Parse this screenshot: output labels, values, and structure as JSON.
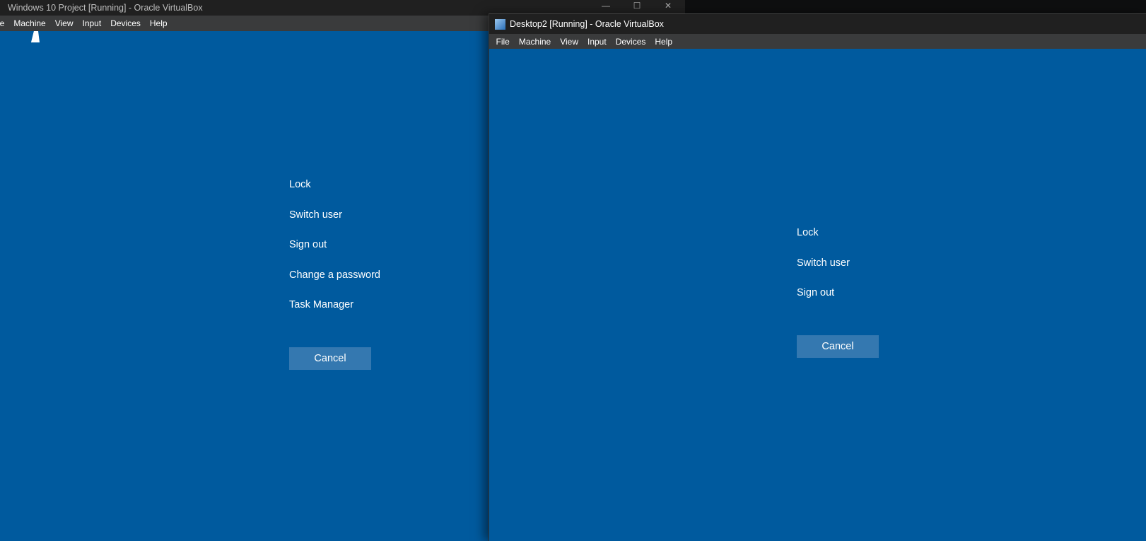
{
  "window1": {
    "title": "Windows 10 Project  [Running] - Oracle VirtualBox",
    "menu": [
      "le",
      "Machine",
      "View",
      "Input",
      "Devices",
      "Help"
    ],
    "options": [
      "Lock",
      "Switch user",
      "Sign out",
      "Change a password",
      "Task Manager"
    ],
    "cancel": "Cancel"
  },
  "window2": {
    "title": "Desktop2 [Running] - Oracle VirtualBox",
    "menu": [
      "File",
      "Machine",
      "View",
      "Input",
      "Devices",
      "Help"
    ],
    "options": [
      "Lock",
      "Switch user",
      "Sign out"
    ],
    "cancel": "Cancel"
  },
  "colors": {
    "background": "#005a9e",
    "button": "#3478b0"
  }
}
